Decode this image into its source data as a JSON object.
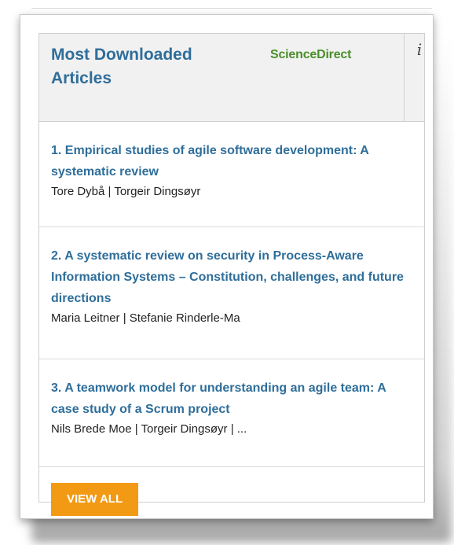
{
  "widget": {
    "title": "Most Downloaded Articles",
    "brand": "ScienceDirect",
    "info_glyph": "i",
    "articles": [
      {
        "title": "1. Empirical studies of agile software development: A systematic review",
        "authors": "Tore Dybå | Torgeir Dingsøyr"
      },
      {
        "title": "2. A systematic review on security in Process-Aware Information Systems – Constitution, challenges, and future directions",
        "authors": "Maria Leitner | Stefanie Rinderle-Ma"
      },
      {
        "title": "3. A teamwork model for understanding an agile team: A case study of a Scrum project",
        "authors": "Nils Brede Moe | Torgeir Dingsøyr | ..."
      }
    ],
    "view_all_label": "VIEW ALL"
  },
  "colors": {
    "link": "#2f6e9a",
    "brand": "#4a8f2a",
    "button": "#f29a14",
    "header_bg": "#f1f1f1"
  }
}
